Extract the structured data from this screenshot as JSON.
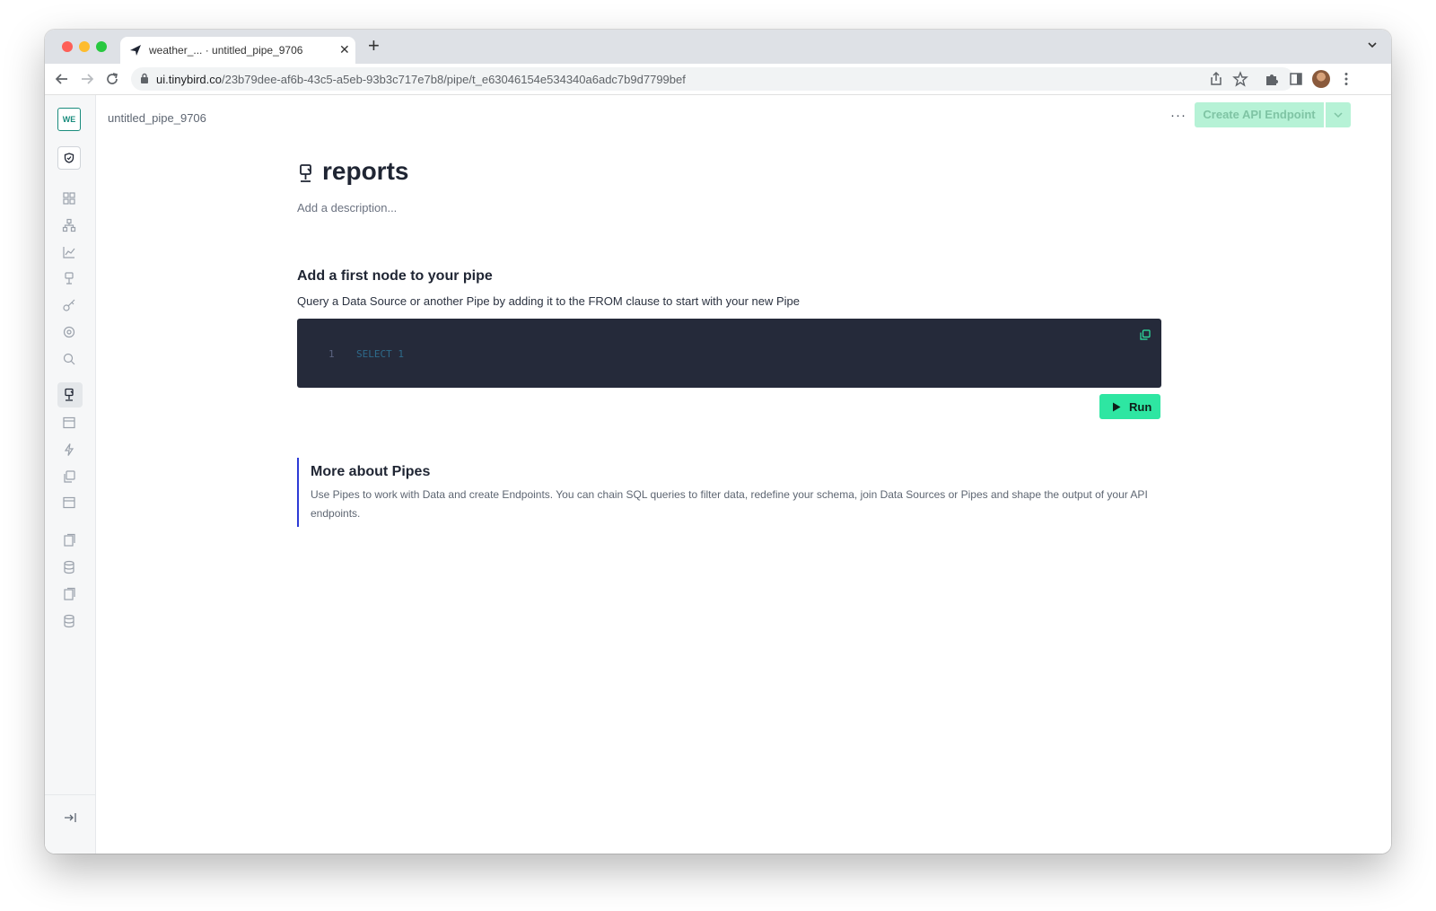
{
  "browser": {
    "tab_title": "weather_... · untitled_pipe_9706",
    "url_host": "ui.tinybird.co",
    "url_path": "/23b79dee-af6b-43c5-a5eb-93b3c717e7b8/pipe/t_e63046154e534340a6adc7b9d7799bef"
  },
  "workspace": {
    "badge": "WE"
  },
  "header": {
    "breadcrumb": "untitled_pipe_9706",
    "more_label": "···",
    "create_button": "Create API Endpoint"
  },
  "pipe": {
    "name": "reports",
    "description_placeholder": "Add a description..."
  },
  "node": {
    "heading": "Add a first node to your pipe",
    "subtitle": "Query a Data Source or another Pipe by adding it to the FROM clause to start with your new Pipe",
    "line_number": "1",
    "sql": "SELECT 1",
    "run_label": "Run"
  },
  "info": {
    "title": "More about Pipes",
    "text": "Use Pipes to work with Data and create Endpoints. You can chain SQL queries to filter data, redefine your schema, join Data Sources or Pipes and shape the output of your API endpoints."
  },
  "sidebar_icons": [
    "grid-icon",
    "hierarchy-icon",
    "chart-icon",
    "pipe-icon",
    "key-icon",
    "settings-icon",
    "search-icon",
    "pipe-icon",
    "datasource-icon",
    "lightning-icon",
    "copy-icon",
    "datasource-icon",
    "pipe-file-icon",
    "database-icon",
    "pipe-file-icon",
    "database-icon"
  ],
  "colors": {
    "accent_green": "#2ee6a2",
    "accent_blue": "#2d3bd6",
    "editor_bg": "#252a3a",
    "workspace_teal": "#1a8c7d"
  }
}
